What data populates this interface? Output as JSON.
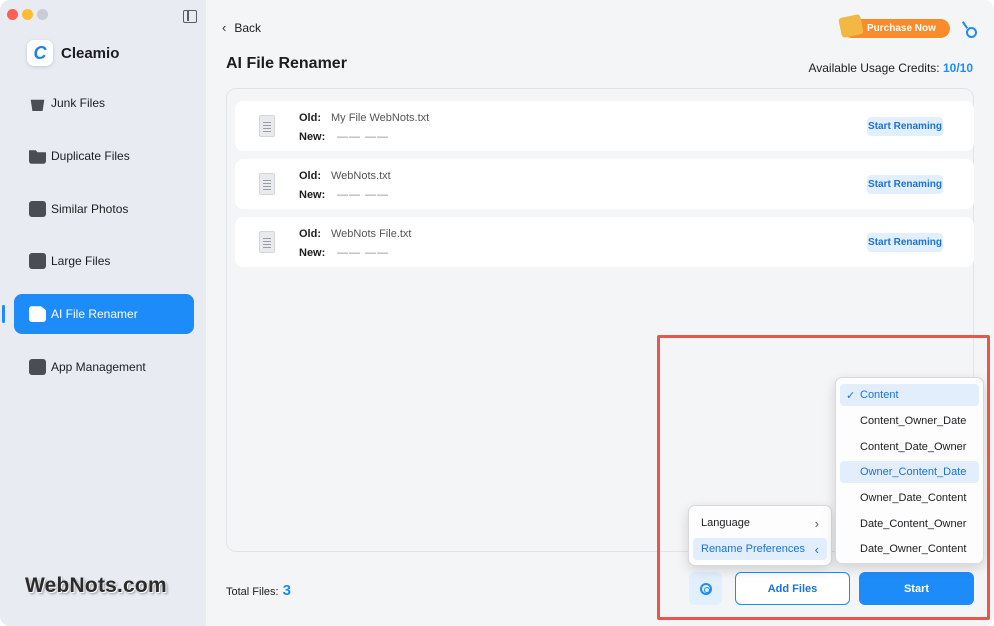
{
  "app": {
    "name": "Cleamio",
    "logo_letter": "C"
  },
  "sidebar": {
    "items": [
      {
        "label": "Junk Files",
        "icon": "broom-icon",
        "active": false
      },
      {
        "label": "Duplicate Files",
        "icon": "folder-icon",
        "active": false
      },
      {
        "label": "Similar Photos",
        "icon": "photo-icon",
        "active": false
      },
      {
        "label": "Large Files",
        "icon": "archive-icon",
        "active": false
      },
      {
        "label": "AI File Renamer",
        "icon": "ai-file-icon",
        "active": true
      },
      {
        "label": "App Management",
        "icon": "app-store-icon",
        "active": false
      }
    ]
  },
  "watermark": "WebNots.com",
  "header": {
    "back_label": "Back",
    "purchase_label": "Purchase Now",
    "title": "AI File Renamer",
    "credits_label": "Available Usage Credits:",
    "credits_value": "10/10"
  },
  "files": {
    "old_label": "Old:",
    "new_label": "New:",
    "button_label": "Start Renaming",
    "rows": [
      {
        "old_name": "My File WebNots.txt",
        "new_name": "—— ——"
      },
      {
        "old_name": "WebNots.txt",
        "new_name": "—— ——"
      },
      {
        "old_name": "WebNots File.txt",
        "new_name": "—— ——"
      }
    ]
  },
  "footer": {
    "total_label": "Total Files:",
    "total_value": "3",
    "add_files_label": "Add Files",
    "start_label": "Start"
  },
  "settings_menu": {
    "items": [
      {
        "label": "Language",
        "arrow": "›"
      },
      {
        "label": "Rename Preferences",
        "arrow": "‹"
      }
    ]
  },
  "preferences_menu": {
    "check": "✓",
    "items": [
      {
        "label": "Content",
        "selected": true
      },
      {
        "label": "Content_Owner_Date"
      },
      {
        "label": "Content_Date_Owner"
      },
      {
        "label": "Owner_Content_Date",
        "hovered": true
      },
      {
        "label": "Owner_Date_Content"
      },
      {
        "label": "Date_Content_Owner"
      },
      {
        "label": "Date_Owner_Content"
      }
    ]
  },
  "colors": {
    "accent": "#1d8cf8",
    "purchase": "#f98b2a",
    "highlight_box": "#e8574c"
  }
}
